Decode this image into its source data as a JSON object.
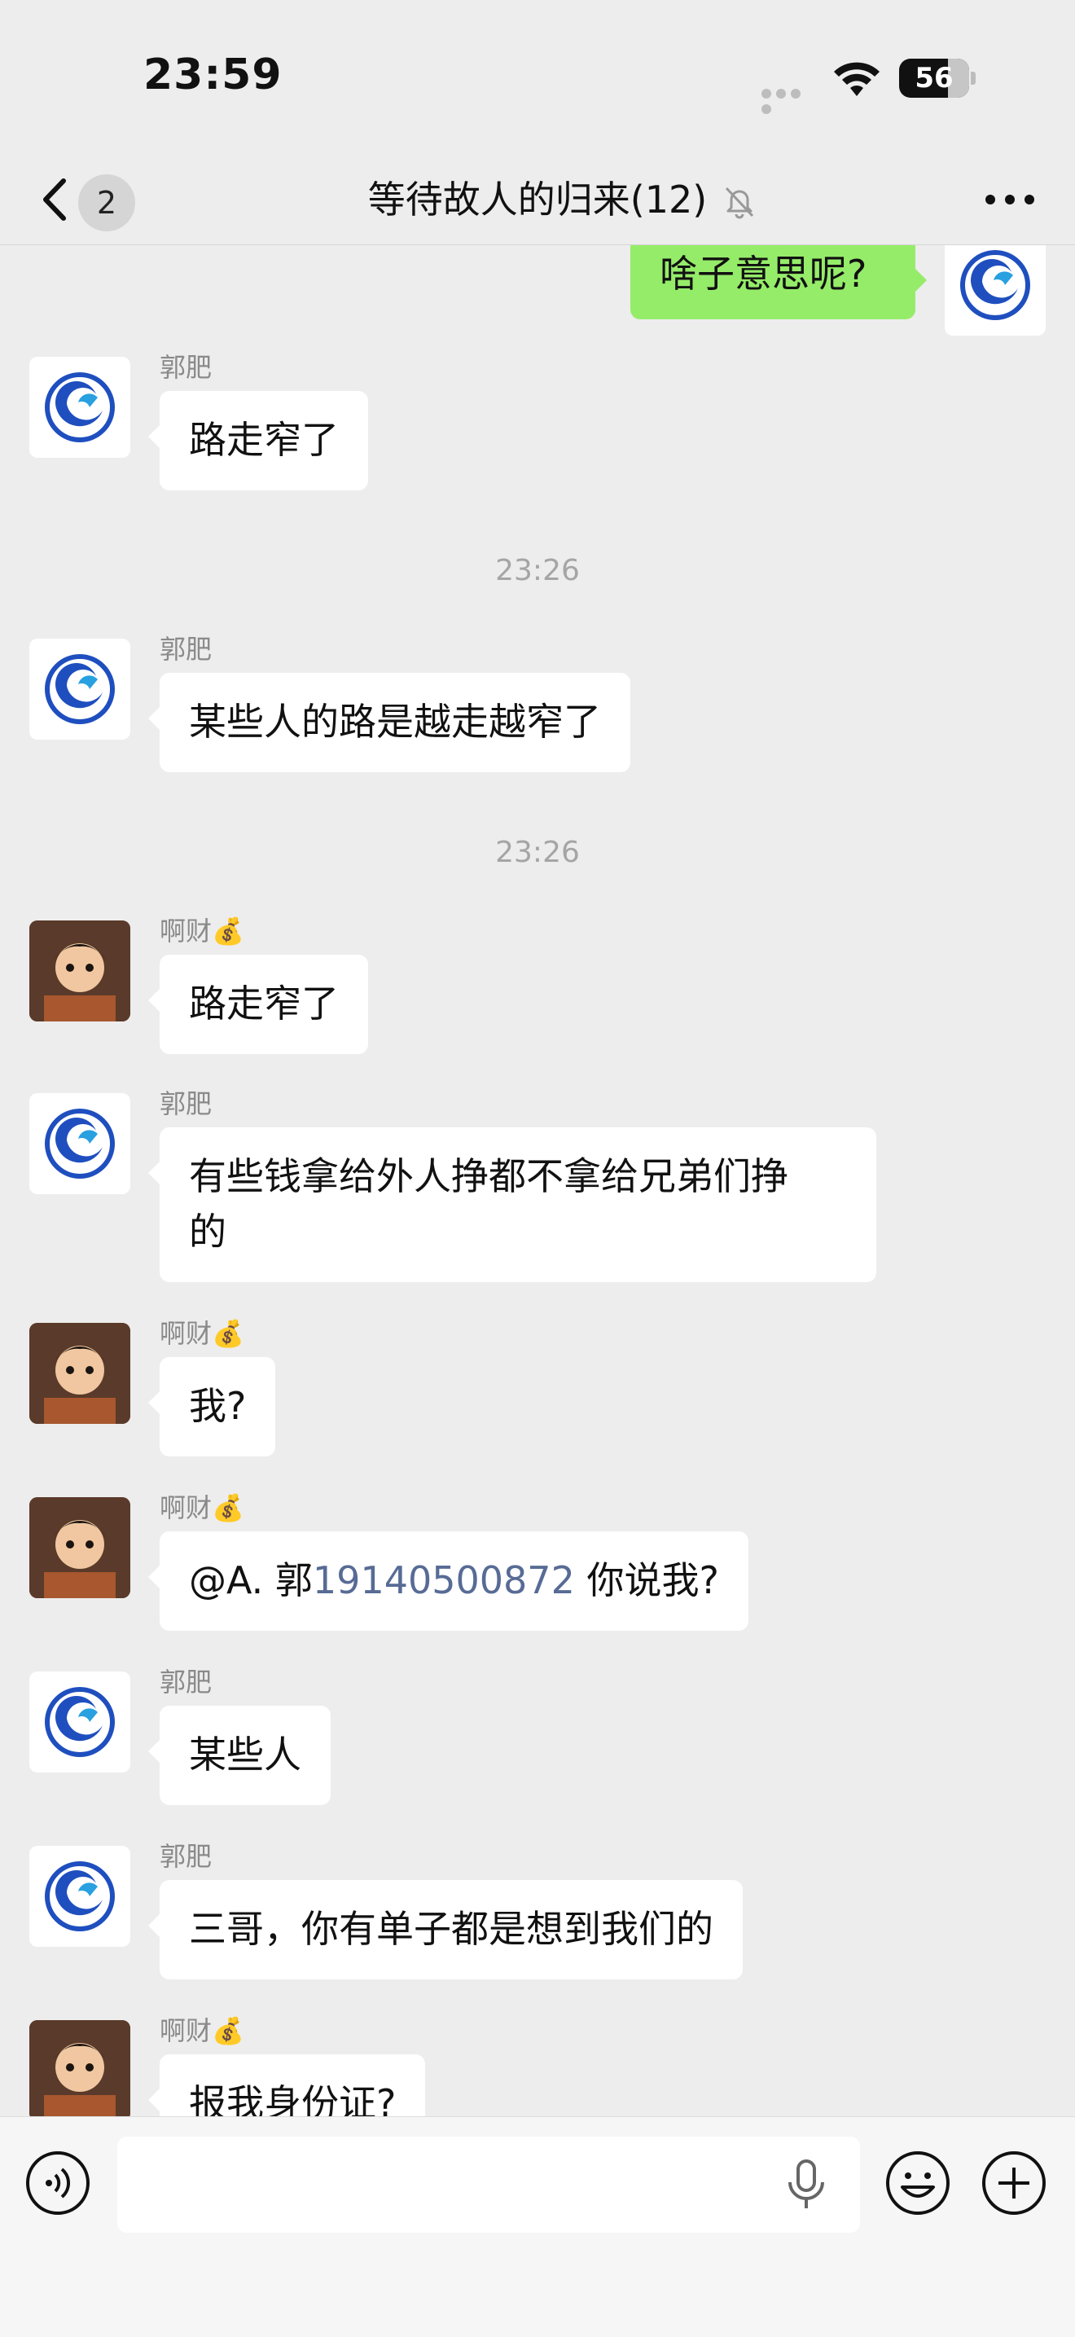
{
  "status_bar": {
    "time": "23:59",
    "battery": "56"
  },
  "nav": {
    "unread_count": "2",
    "title": "等待故人的归来(12)"
  },
  "messages": [
    {
      "type": "mine",
      "text": "啥子意思呢?"
    },
    {
      "type": "other",
      "sender": "郭肥",
      "text": "路走窄了"
    },
    {
      "type": "time",
      "text": "23:26"
    },
    {
      "type": "other",
      "sender": "郭肥",
      "text": "某些人的路是越走越窄了"
    },
    {
      "type": "time",
      "text": "23:26"
    },
    {
      "type": "other",
      "sender": "啊财💰",
      "text": "路走窄了"
    },
    {
      "type": "other",
      "sender": "郭肥",
      "text_line1": "有些钱拿给外人挣都不拿给兄弟们挣",
      "text_line2": "的"
    },
    {
      "type": "other",
      "sender": "啊财💰",
      "text": "我?"
    },
    {
      "type": "other",
      "sender": "啊财💰",
      "text_prefix": "@A. 郭",
      "text_number": "19140500872",
      "text_suffix": " 你说我?"
    },
    {
      "type": "other",
      "sender": "郭肥",
      "text": "某些人"
    },
    {
      "type": "other",
      "sender": "郭肥",
      "text": "三哥，你有单子都是想到我们的"
    },
    {
      "type": "other",
      "sender": "啊财💰",
      "text": "报我身份证?"
    }
  ],
  "input": {
    "placeholder": ""
  },
  "colors": {
    "background": "#ededed",
    "my_bubble": "#95ec69",
    "other_bubble": "#ffffff",
    "mention_link": "#576b95"
  },
  "icons": [
    "chevron-left-icon",
    "mute-bell-icon",
    "more-icon",
    "voice-icon",
    "mic-icon",
    "emoji-icon",
    "plus-icon",
    "wifi-icon"
  ]
}
